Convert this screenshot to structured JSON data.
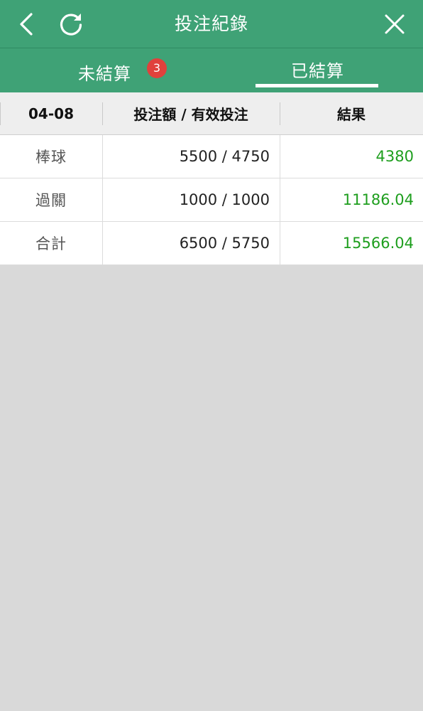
{
  "header": {
    "title": "投注紀錄"
  },
  "tabs": {
    "unsettled_label": "未結算",
    "unsettled_count": "3",
    "settled_label": "已結算",
    "active": "settled"
  },
  "table": {
    "headers": {
      "date": "04-08",
      "amount": "投注額 / 有效投注",
      "result": "結果"
    },
    "rows": [
      {
        "type": "棒球",
        "amount": "5500 / 4750",
        "result": "4380"
      },
      {
        "type": "過關",
        "amount": "1000 / 1000",
        "result": "11186.04"
      },
      {
        "type": "合計",
        "amount": "6500 / 5750",
        "result": "15566.04"
      }
    ]
  },
  "colors": {
    "primary_green": "#3fa276",
    "badge_red": "#e0413c",
    "result_green": "#1e9e1e",
    "background": "#d9d9d9"
  },
  "icons": {
    "back": "chevron-left-icon",
    "refresh": "refresh-icon",
    "close": "close-icon"
  }
}
